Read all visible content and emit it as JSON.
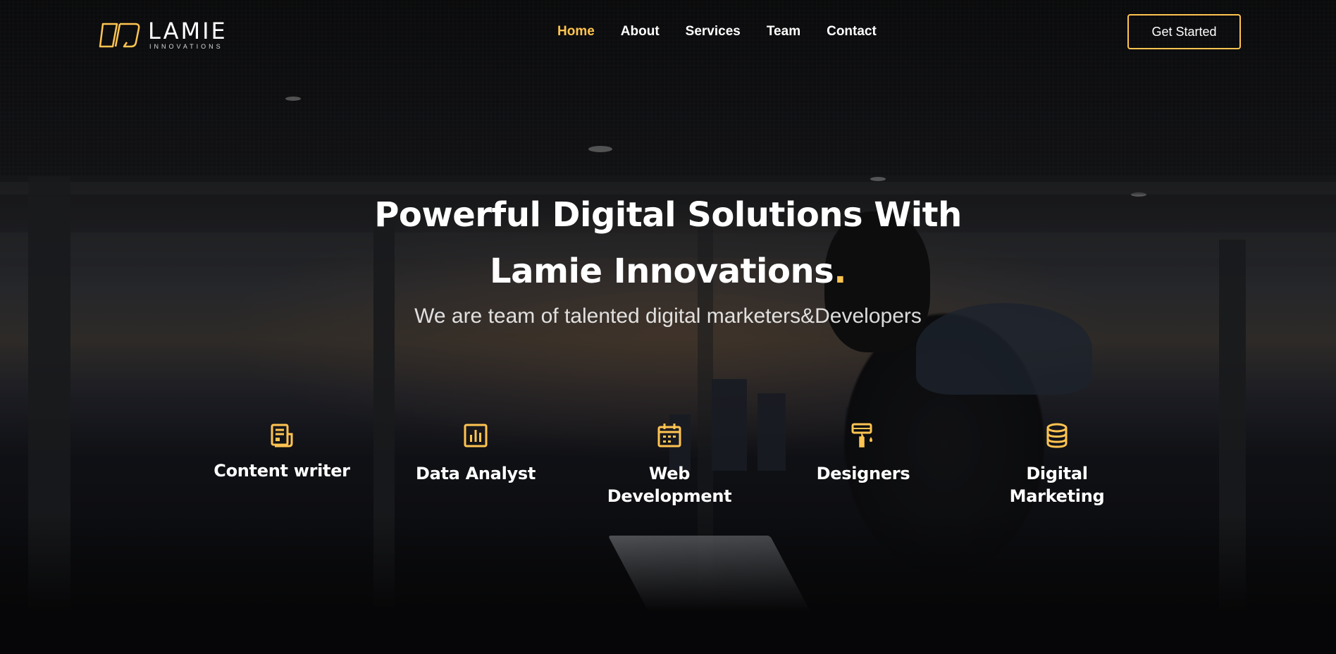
{
  "brand": {
    "name": "LAMIE",
    "tagline": "INNOVATIONS",
    "accent_color": "#ffc451"
  },
  "nav": {
    "items": [
      {
        "label": "Home",
        "active": true
      },
      {
        "label": "About",
        "active": false
      },
      {
        "label": "Services",
        "active": false
      },
      {
        "label": "Team",
        "active": false
      },
      {
        "label": "Contact",
        "active": false
      }
    ],
    "cta_label": "Get Started"
  },
  "hero": {
    "title_line1": "Powerful Digital Solutions With",
    "title_line2": "Lamie Innovations",
    "title_dot": ".",
    "subtitle": "We are team of talented digital marketers&Developers"
  },
  "services": [
    {
      "label": "Content writer",
      "icon": "document-icon"
    },
    {
      "label": "Data Analyst",
      "icon": "bar-chart-icon"
    },
    {
      "label": "Web Development",
      "icon": "calendar-icon"
    },
    {
      "label": "Designers",
      "icon": "paint-roller-icon"
    },
    {
      "label": "Digital Marketing",
      "icon": "database-icon"
    }
  ]
}
